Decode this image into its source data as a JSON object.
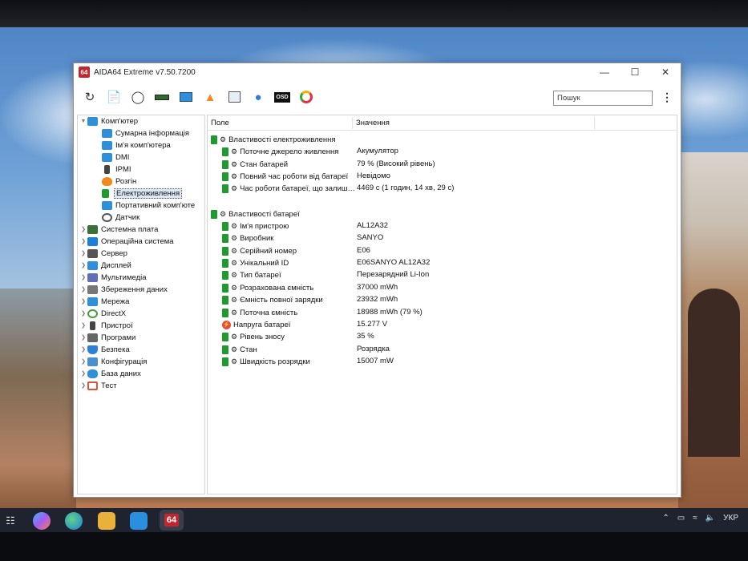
{
  "window": {
    "title": "AIDA64 Extreme v7.50.7200",
    "app_icon": "64"
  },
  "toolbar": {
    "search_placeholder": "Пошук"
  },
  "tree": {
    "items": [
      {
        "label": "Комп'ютер",
        "icon": "monitor-icon",
        "color": "#2f8fd8",
        "expanded": true
      },
      {
        "label": "Сумарна інформація",
        "icon": "monitor-icon",
        "color": "#2f8fd8"
      },
      {
        "label": "Ім'я комп'ютера",
        "icon": "monitor-icon",
        "color": "#2f8fd8"
      },
      {
        "label": "DMI",
        "icon": "monitor-icon",
        "color": "#2f8fd8"
      },
      {
        "label": "IPMI",
        "icon": "phone-icon",
        "color": "#444444"
      },
      {
        "label": "Розгін",
        "icon": "flame-icon",
        "color": "#f08a1c"
      },
      {
        "label": "Електроживлення",
        "icon": "battery-icon",
        "color": "#1f9a2e",
        "selected": true
      },
      {
        "label": "Портативний комп'юте",
        "icon": "laptop-icon",
        "color": "#2f8fd8"
      },
      {
        "label": "Датчик",
        "icon": "gauge-icon",
        "color": "#555555"
      },
      {
        "label": "Системна плата",
        "icon": "board-icon",
        "color": "#3a6f3a"
      },
      {
        "label": "Операційна система",
        "icon": "windows-icon",
        "color": "#1e7fd6"
      },
      {
        "label": "Сервер",
        "icon": "server-icon",
        "color": "#555555"
      },
      {
        "label": "Дисплей",
        "icon": "display-icon",
        "color": "#2f8fd8"
      },
      {
        "label": "Мультимедіа",
        "icon": "speaker-icon",
        "color": "#5f6fb8"
      },
      {
        "label": "Збереження даних",
        "icon": "disk-icon",
        "color": "#777777"
      },
      {
        "label": "Мережа",
        "icon": "network-icon",
        "color": "#2f8fd8"
      },
      {
        "label": "DirectX",
        "icon": "directx-icon",
        "color": "#4a9a3a"
      },
      {
        "label": "Пристрої",
        "icon": "device-icon",
        "color": "#444444"
      },
      {
        "label": "Програми",
        "icon": "programs-icon",
        "color": "#666666"
      },
      {
        "label": "Безпека",
        "icon": "shield-icon",
        "color": "#2f7fd6"
      },
      {
        "label": "Конфігурація",
        "icon": "config-icon",
        "color": "#4b8fd0"
      },
      {
        "label": "База даних",
        "icon": "database-icon",
        "color": "#2f8fd8"
      },
      {
        "label": "Тест",
        "icon": "test-icon",
        "color": "#d8553a"
      }
    ]
  },
  "list": {
    "header_field": "Поле",
    "header_value": "Значення",
    "groups": [
      {
        "title": "Властивості електроживлення",
        "rows": [
          {
            "field": "Поточне джерело живлення",
            "value": "Акумулятор"
          },
          {
            "field": "Стан батарей",
            "value": "79 % (Високий рівень)"
          },
          {
            "field": "Повний час роботи від батареї",
            "value": "Невідомо"
          },
          {
            "field": "Час роботи батареї, що залиш…",
            "value": "4469 с (1 годин, 14 хв, 29 с)"
          }
        ]
      },
      {
        "title": "Властивості батареї",
        "rows": [
          {
            "field": "Ім'я пристрою",
            "value": "AL12A32"
          },
          {
            "field": "Виробник",
            "value": "SANYO"
          },
          {
            "field": "Серійний номер",
            "value": "E06"
          },
          {
            "field": "Унікальний ID",
            "value": "E06SANYO AL12A32"
          },
          {
            "field": "Тип батареї",
            "value": "Перезарядний Li-Ion"
          },
          {
            "field": "Розрахована ємність",
            "value": "37000 mWh"
          },
          {
            "field": "Ємність повної зарядки",
            "value": "23932 mWh"
          },
          {
            "field": "Поточна ємність",
            "value": "18988 mWh  (79 %)"
          },
          {
            "field": "Напруга батареї",
            "value": "15.277 V",
            "icon": "voltage-icon"
          },
          {
            "field": "Рівень зносу",
            "value": "35 %"
          },
          {
            "field": "Стан",
            "value": "Розрядка"
          },
          {
            "field": "Швидкість розрядки",
            "value": "15007 mW"
          }
        ]
      }
    ]
  },
  "taskbar": {
    "items": [
      "taskview",
      "copilot",
      "edge",
      "explorer",
      "mail",
      "aida64"
    ],
    "aida_label": "64",
    "language": "УКР"
  }
}
